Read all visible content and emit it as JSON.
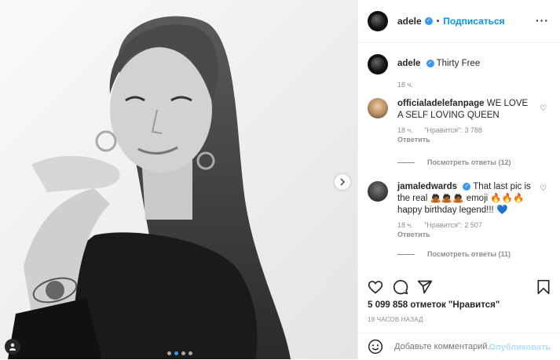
{
  "post": {
    "author": "adele",
    "follow_label": "Подписаться",
    "more_icon": "more-horizontal-icon",
    "caption_text": "Thirty Free",
    "caption_time": "18 ч."
  },
  "comments": [
    {
      "username": "officialadelefanpage",
      "text": "WE LOVE A SELF LOVING QUEEN",
      "time": "18 ч.",
      "likes": "\"Нравится\": 3 788",
      "reply": "Ответить",
      "view_replies": "Посмотреть ответы (12)"
    },
    {
      "username": "jamaledwards",
      "text": "That last pic is the real 🙇🏾🙇🏾🙇🏾 emoji 🔥🔥🔥 happy birthday legend!!! 💙",
      "time": "18 ч.",
      "likes": "\"Нравится\": 2 507",
      "reply": "Ответить",
      "view_replies": "Посмотреть ответы (11)"
    }
  ],
  "stats": {
    "likes_text": "5 099 858 отметок \"Нравится\"",
    "time_ago": "18 ЧАСОВ НАЗАД"
  },
  "composer": {
    "placeholder": "Добавьте комментарий...",
    "publish_label": "Опубликовать"
  },
  "media": {
    "carousel_count": 4,
    "active_index": 1
  },
  "colors": {
    "link_blue": "#0095f6",
    "verified_blue": "#3897f0",
    "muted": "#8e8e8e"
  }
}
